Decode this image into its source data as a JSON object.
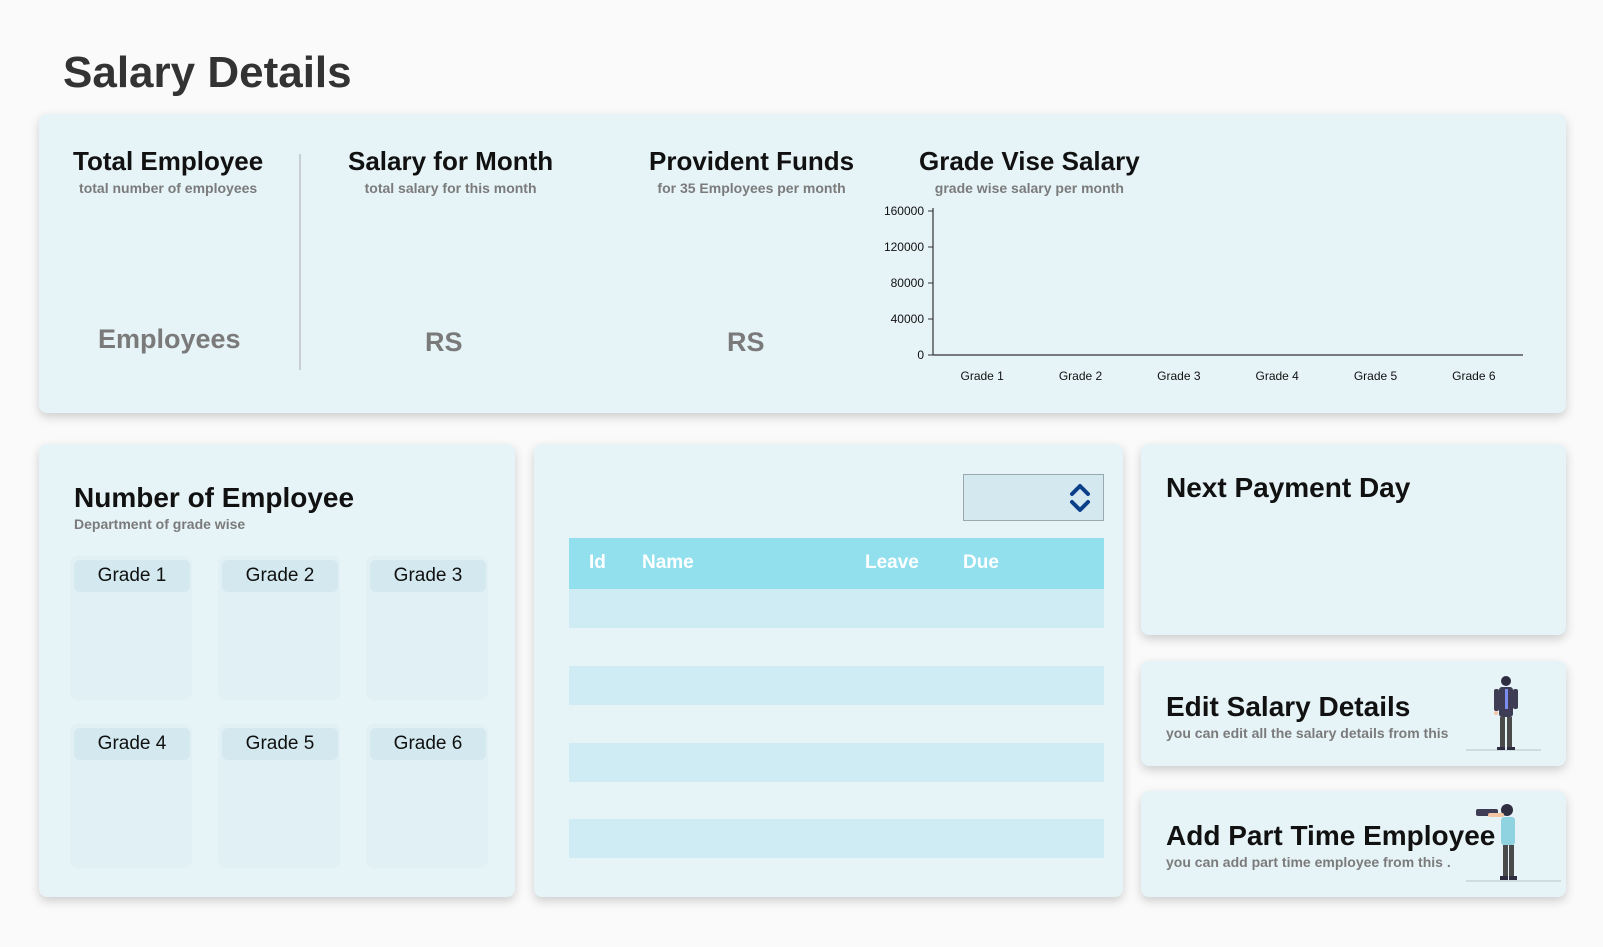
{
  "page": {
    "title": "Salary Details"
  },
  "stats": {
    "employees": {
      "title": "Total Employee",
      "subtitle": "total number of employees",
      "value": "Employees"
    },
    "salary": {
      "title": "Salary for Month",
      "subtitle": "total salary for this month",
      "value": "RS"
    },
    "provident": {
      "title": "Provident Funds",
      "subtitle": "for 35 Employees per month",
      "value": "RS"
    },
    "grade_salary": {
      "title": "Grade Vise Salary",
      "subtitle": "grade wise salary per month"
    }
  },
  "chart_data": {
    "type": "bar",
    "title": "Grade Vise Salary",
    "subtitle": "grade wise salary per month",
    "categories": [
      "Grade 1",
      "Grade 2",
      "Grade 3",
      "Grade 4",
      "Grade 5",
      "Grade 6"
    ],
    "values": [
      0,
      0,
      0,
      0,
      0,
      0
    ],
    "yticks": [
      "0",
      "40000",
      "80000",
      "120000",
      "160000"
    ],
    "ylim": [
      0,
      160000
    ],
    "xlabel": "",
    "ylabel": "",
    "grid": false
  },
  "number_of_employee": {
    "title": "Number of Employee",
    "subtitle": "Department of grade wise",
    "grades": [
      "Grade 1",
      "Grade 2",
      "Grade 3",
      "Grade 4",
      "Grade 5",
      "Grade 6"
    ]
  },
  "table": {
    "columns": [
      "Id",
      "Name",
      "Leave",
      "Due"
    ],
    "rows": 4
  },
  "next_payment": {
    "title": "Next Payment Day"
  },
  "edit_salary": {
    "title": "Edit Salary Details",
    "subtitle": "you can edit all the salary details from this"
  },
  "add_part_time": {
    "title": "Add Part Time Employee",
    "subtitle": "you can add part time employee from this ."
  },
  "colors": {
    "background": "#fafafa",
    "card": "#e6f3f7",
    "table_header": "#92dfee",
    "table_row": "#cfebf3",
    "select_arrow": "#0a3f8a"
  },
  "icons": {
    "sort": "up-down-chevron-icon",
    "edit_illustration": "standing-man-illustration",
    "add_illustration": "man-with-binoculars-illustration"
  }
}
